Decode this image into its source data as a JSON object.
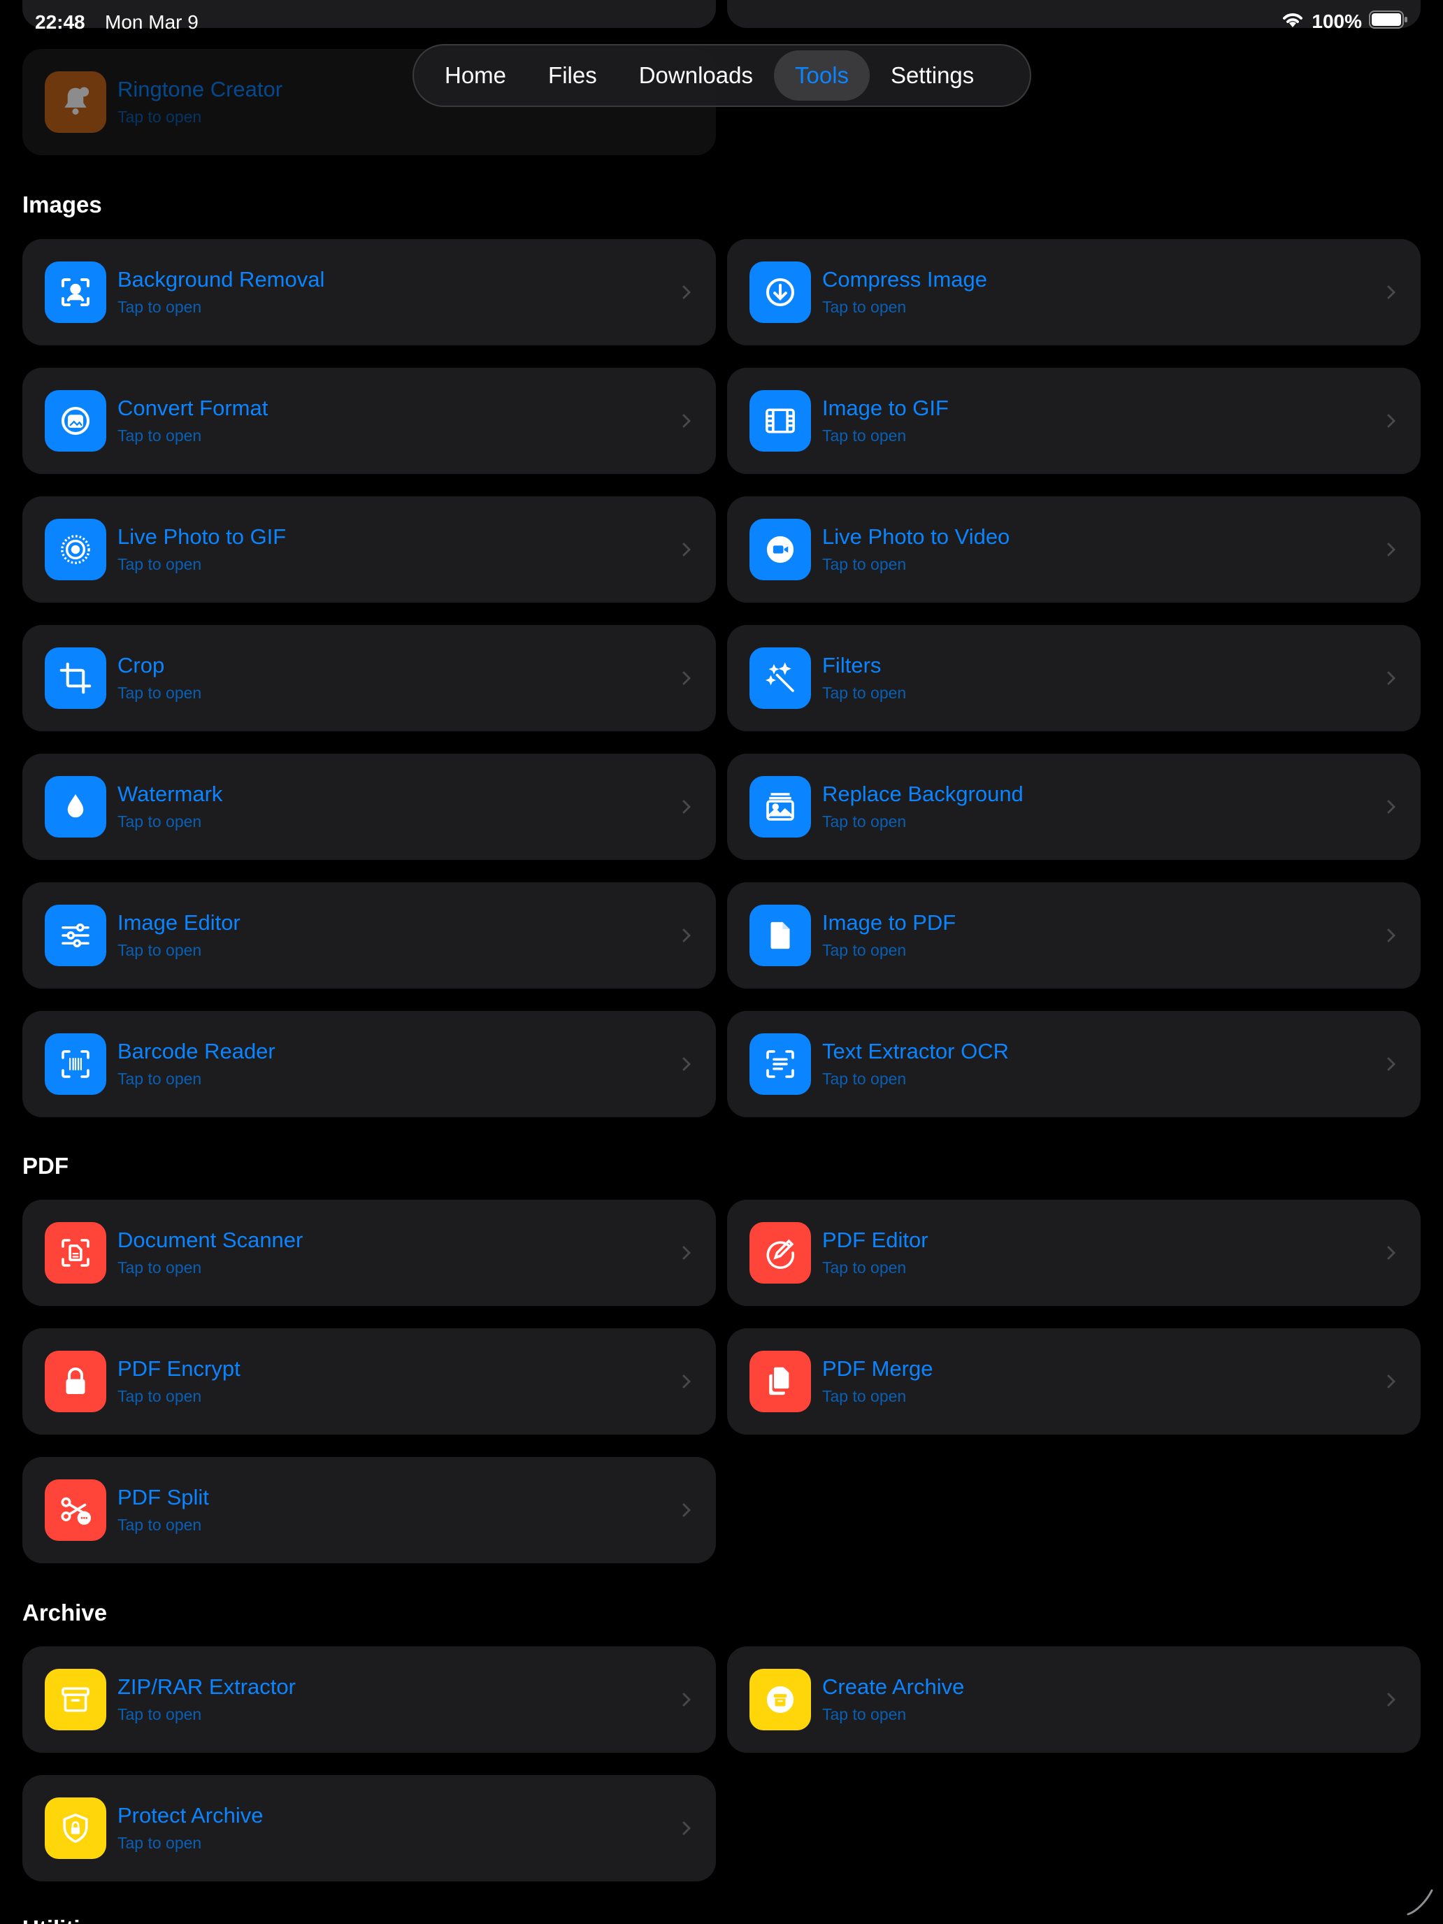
{
  "status": {
    "time": "22:48",
    "date": "Mon Mar 9",
    "battery": "100%"
  },
  "tabs": [
    {
      "label": "Home",
      "active": false
    },
    {
      "label": "Files",
      "active": false
    },
    {
      "label": "Downloads",
      "active": false
    },
    {
      "label": "Tools",
      "active": true
    },
    {
      "label": "Settings",
      "active": false
    }
  ],
  "colors": {
    "accent": "#0a84ff",
    "images": "#0a84ff",
    "pdf": "#ff453a",
    "archive": "#ffd60a",
    "audio": "#e07a1f"
  },
  "top": {
    "ringtone": {
      "title": "Ringtone Creator",
      "subtitle": "Tap to open",
      "icon": "bell-icon"
    }
  },
  "sections": {
    "images": {
      "title": "Images",
      "items": [
        {
          "title": "Background Removal",
          "subtitle": "Tap to open",
          "icon": "person-viewfinder-icon"
        },
        {
          "title": "Compress Image",
          "subtitle": "Tap to open",
          "icon": "arrow-down-circle-icon"
        },
        {
          "title": "Convert Format",
          "subtitle": "Tap to open",
          "icon": "photo-circle-icon"
        },
        {
          "title": "Image to GIF",
          "subtitle": "Tap to open",
          "icon": "film-icon"
        },
        {
          "title": "Live Photo to GIF",
          "subtitle": "Tap to open",
          "icon": "livephoto-icon"
        },
        {
          "title": "Live Photo to Video",
          "subtitle": "Tap to open",
          "icon": "video-circle-icon"
        },
        {
          "title": "Crop",
          "subtitle": "Tap to open",
          "icon": "crop-icon"
        },
        {
          "title": "Filters",
          "subtitle": "Tap to open",
          "icon": "magic-wand-icon"
        },
        {
          "title": "Watermark",
          "subtitle": "Tap to open",
          "icon": "drop-icon"
        },
        {
          "title": "Replace Background",
          "subtitle": "Tap to open",
          "icon": "photo-stack-icon"
        },
        {
          "title": "Image Editor",
          "subtitle": "Tap to open",
          "icon": "sliders-icon"
        },
        {
          "title": "Image to PDF",
          "subtitle": "Tap to open",
          "icon": "document-icon"
        },
        {
          "title": "Barcode Reader",
          "subtitle": "Tap to open",
          "icon": "barcode-viewfinder-icon"
        },
        {
          "title": "Text Extractor OCR",
          "subtitle": "Tap to open",
          "icon": "text-viewfinder-icon"
        }
      ]
    },
    "pdf": {
      "title": "PDF",
      "items": [
        {
          "title": "Document Scanner",
          "subtitle": "Tap to open",
          "icon": "doc-viewfinder-icon"
        },
        {
          "title": "PDF Editor",
          "subtitle": "Tap to open",
          "icon": "pencil-circle-icon"
        },
        {
          "title": "PDF Encrypt",
          "subtitle": "Tap to open",
          "icon": "lock-icon"
        },
        {
          "title": "PDF Merge",
          "subtitle": "Tap to open",
          "icon": "docs-stack-icon"
        },
        {
          "title": "PDF Split",
          "subtitle": "Tap to open",
          "icon": "scissors-icon"
        }
      ]
    },
    "archive": {
      "title": "Archive",
      "items": [
        {
          "title": "ZIP/RAR Extractor",
          "subtitle": "Tap to open",
          "icon": "archive-box-icon"
        },
        {
          "title": "Create Archive",
          "subtitle": "Tap to open",
          "icon": "archive-circle-icon"
        },
        {
          "title": "Protect Archive",
          "subtitle": "Tap to open",
          "icon": "lock-shield-icon"
        }
      ]
    },
    "utilities": {
      "title": "Utilities"
    }
  }
}
